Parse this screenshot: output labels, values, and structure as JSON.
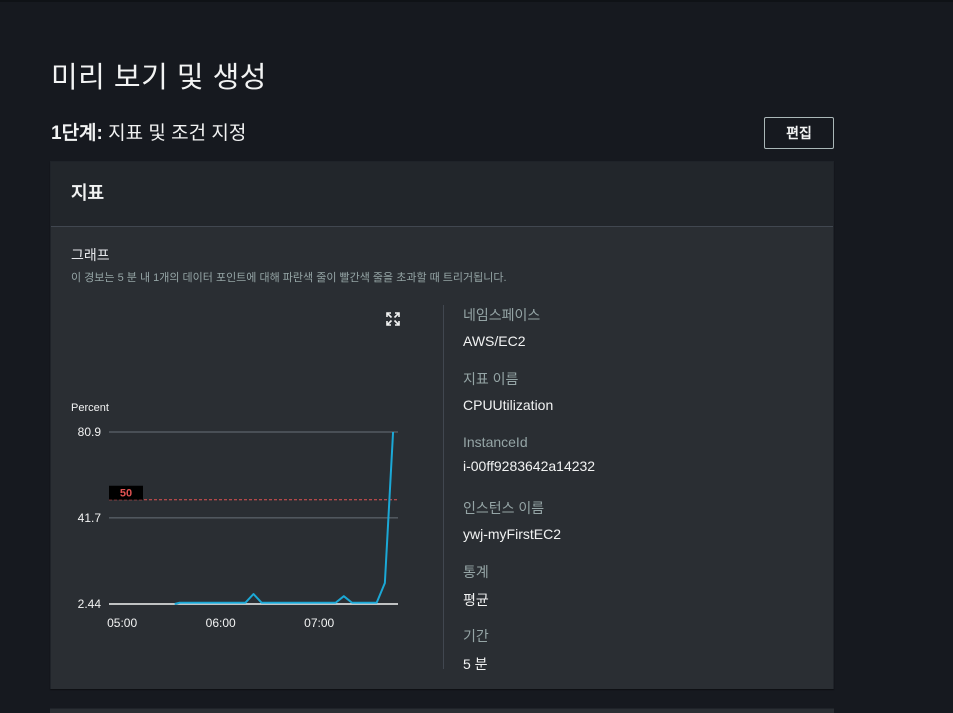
{
  "page": {
    "title": "미리 보기 및 생성"
  },
  "step": {
    "prefix": "1단계:",
    "title": " 지표 및 조건 지정",
    "edit_label": "편집"
  },
  "panel": {
    "title": "지표",
    "graph_label": "그래프",
    "graph_desc": "이 경보는 5 분 내 1개의 데이터 포인트에 대해 파란색 줄이 빨간색 줄을 초과할 때 트리거됩니다."
  },
  "meta": [
    {
      "label": "네임스페이스",
      "value": "AWS/EC2"
    },
    {
      "label": "지표 이름",
      "value": "CPUUtilization"
    },
    {
      "label": "InstanceId",
      "value": "i-00ff9283642a14232"
    },
    {
      "label": "인스턴스 이름",
      "value": "ywj-myFirstEC2"
    },
    {
      "label": "통계",
      "value": "평균"
    },
    {
      "label": "기간",
      "value": "5 분"
    }
  ],
  "chart_data": {
    "type": "line",
    "ylabel": "Percent",
    "ylim": [
      2.44,
      80.9
    ],
    "y_ticks": [
      "80.9",
      "41.7",
      "2.44"
    ],
    "y_tick_values": [
      80.9,
      41.7,
      2.44
    ],
    "x_ticks": [
      "05:00",
      "06:00",
      "07:00"
    ],
    "x_tick_minutes": [
      300,
      360,
      420
    ],
    "xlim_minutes": [
      292,
      468
    ],
    "threshold": {
      "value": 50,
      "label": "50",
      "color": "#e05252"
    },
    "series": [
      {
        "name": "CPUUtilization",
        "color": "#1ba8d6",
        "x_minutes": [
          332,
          335,
          340,
          345,
          350,
          355,
          360,
          365,
          370,
          375,
          380,
          385,
          390,
          395,
          400,
          405,
          410,
          415,
          420,
          425,
          430,
          435,
          440,
          445,
          450,
          455,
          460,
          465
        ],
        "y": [
          2.44,
          3.0,
          3.0,
          3.0,
          3.0,
          3.0,
          3.0,
          3.0,
          3.0,
          3.0,
          7.0,
          3.0,
          3.0,
          3.0,
          3.0,
          3.0,
          3.0,
          3.0,
          3.0,
          3.0,
          3.0,
          6.0,
          3.0,
          3.0,
          3.0,
          3.0,
          12.0,
          80.9
        ]
      }
    ]
  },
  "colors": {
    "background": "#16191f",
    "panel": "#2a2e33",
    "accent_line": "#1ba8d6",
    "threshold": "#e05252"
  }
}
